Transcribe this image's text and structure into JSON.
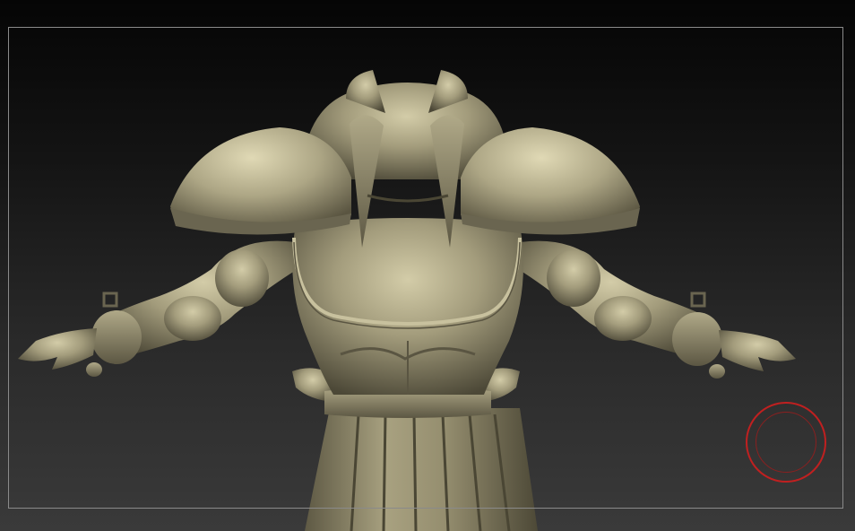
{
  "canvas": {
    "background_top": "#050505",
    "background_bottom": "#3a3a3a",
    "frame_color": "#8a8a8a"
  },
  "model": {
    "material_color": "#9c9677",
    "shadow_color": "#4a4635",
    "highlight_color": "#d6d0ad"
  },
  "navigator": {
    "icon": "rotation-gyro-icon",
    "color": "#c02020"
  }
}
